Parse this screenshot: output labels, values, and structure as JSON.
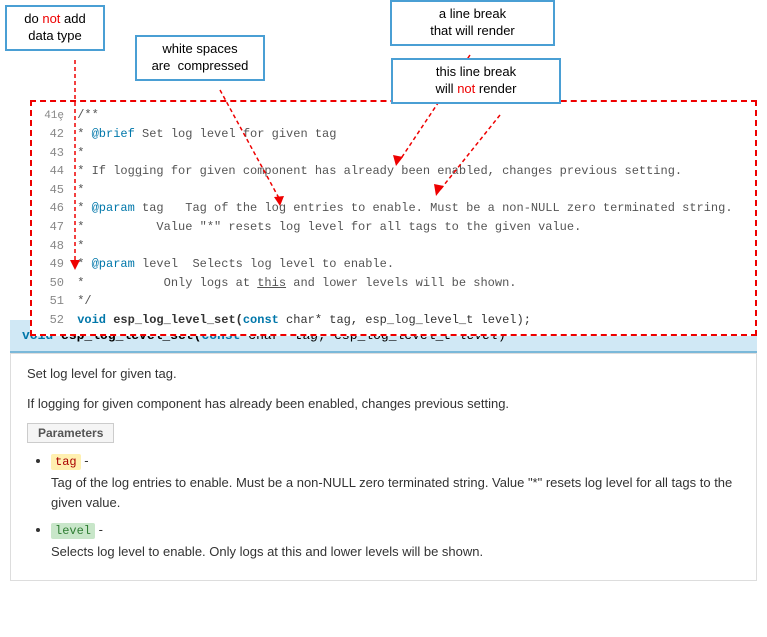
{
  "annotations": {
    "do_not": {
      "line1": "do ",
      "not": "not",
      "line2": " add",
      "line3": "data type"
    },
    "white_spaces": {
      "line1": "white spaces",
      "line2": "are  compressed"
    },
    "line_break_render": {
      "line1": "a line break",
      "line2": "that will render"
    },
    "line_break_not": {
      "line1": "this line break",
      "not": "not",
      "line2": " render"
    }
  },
  "code": {
    "lines": [
      {
        "num": "41",
        "fold": true,
        "content": "/**"
      },
      {
        "num": "42",
        "content": " * @brief Set log level for given tag"
      },
      {
        "num": "43",
        "content": " *"
      },
      {
        "num": "44",
        "content": " * If logging for given component has already been enabled, changes previous setting."
      },
      {
        "num": "45",
        "content": " *"
      },
      {
        "num": "46",
        "content": " * @param tag   Tag of the log entries to enable. Must be a non-NULL zero terminated string."
      },
      {
        "num": "47",
        "content": " *              Value \"*\" resets log level for all tags to the given value."
      },
      {
        "num": "48",
        "content": " *"
      },
      {
        "num": "49",
        "content": " * @param level  Selects log level to enable."
      },
      {
        "num": "50",
        "content": " *               Only logs at this and lower levels will be shown."
      },
      {
        "num": "51",
        "content": " */"
      },
      {
        "num": "52",
        "content": "void esp_log_level_set(const char* tag, esp_log_level_t level);"
      }
    ]
  },
  "doc": {
    "function_signature": "void esp_log_level_set(const char *tag, esp_log_level_t level)",
    "description1": "Set log level for given tag.",
    "description2": "If logging for given component has already been enabled, changes previous setting.",
    "params_label": "Parameters",
    "params": [
      {
        "name": "tag",
        "dash": " -",
        "desc": "Tag of the log entries to enable. Must be a non-NULL zero terminated string. Value \"*\" resets log level for all tags to the given value."
      },
      {
        "name": "level",
        "dash": " -",
        "desc": "Selects log level to enable. Only logs at this and lower levels will be shown."
      }
    ]
  }
}
